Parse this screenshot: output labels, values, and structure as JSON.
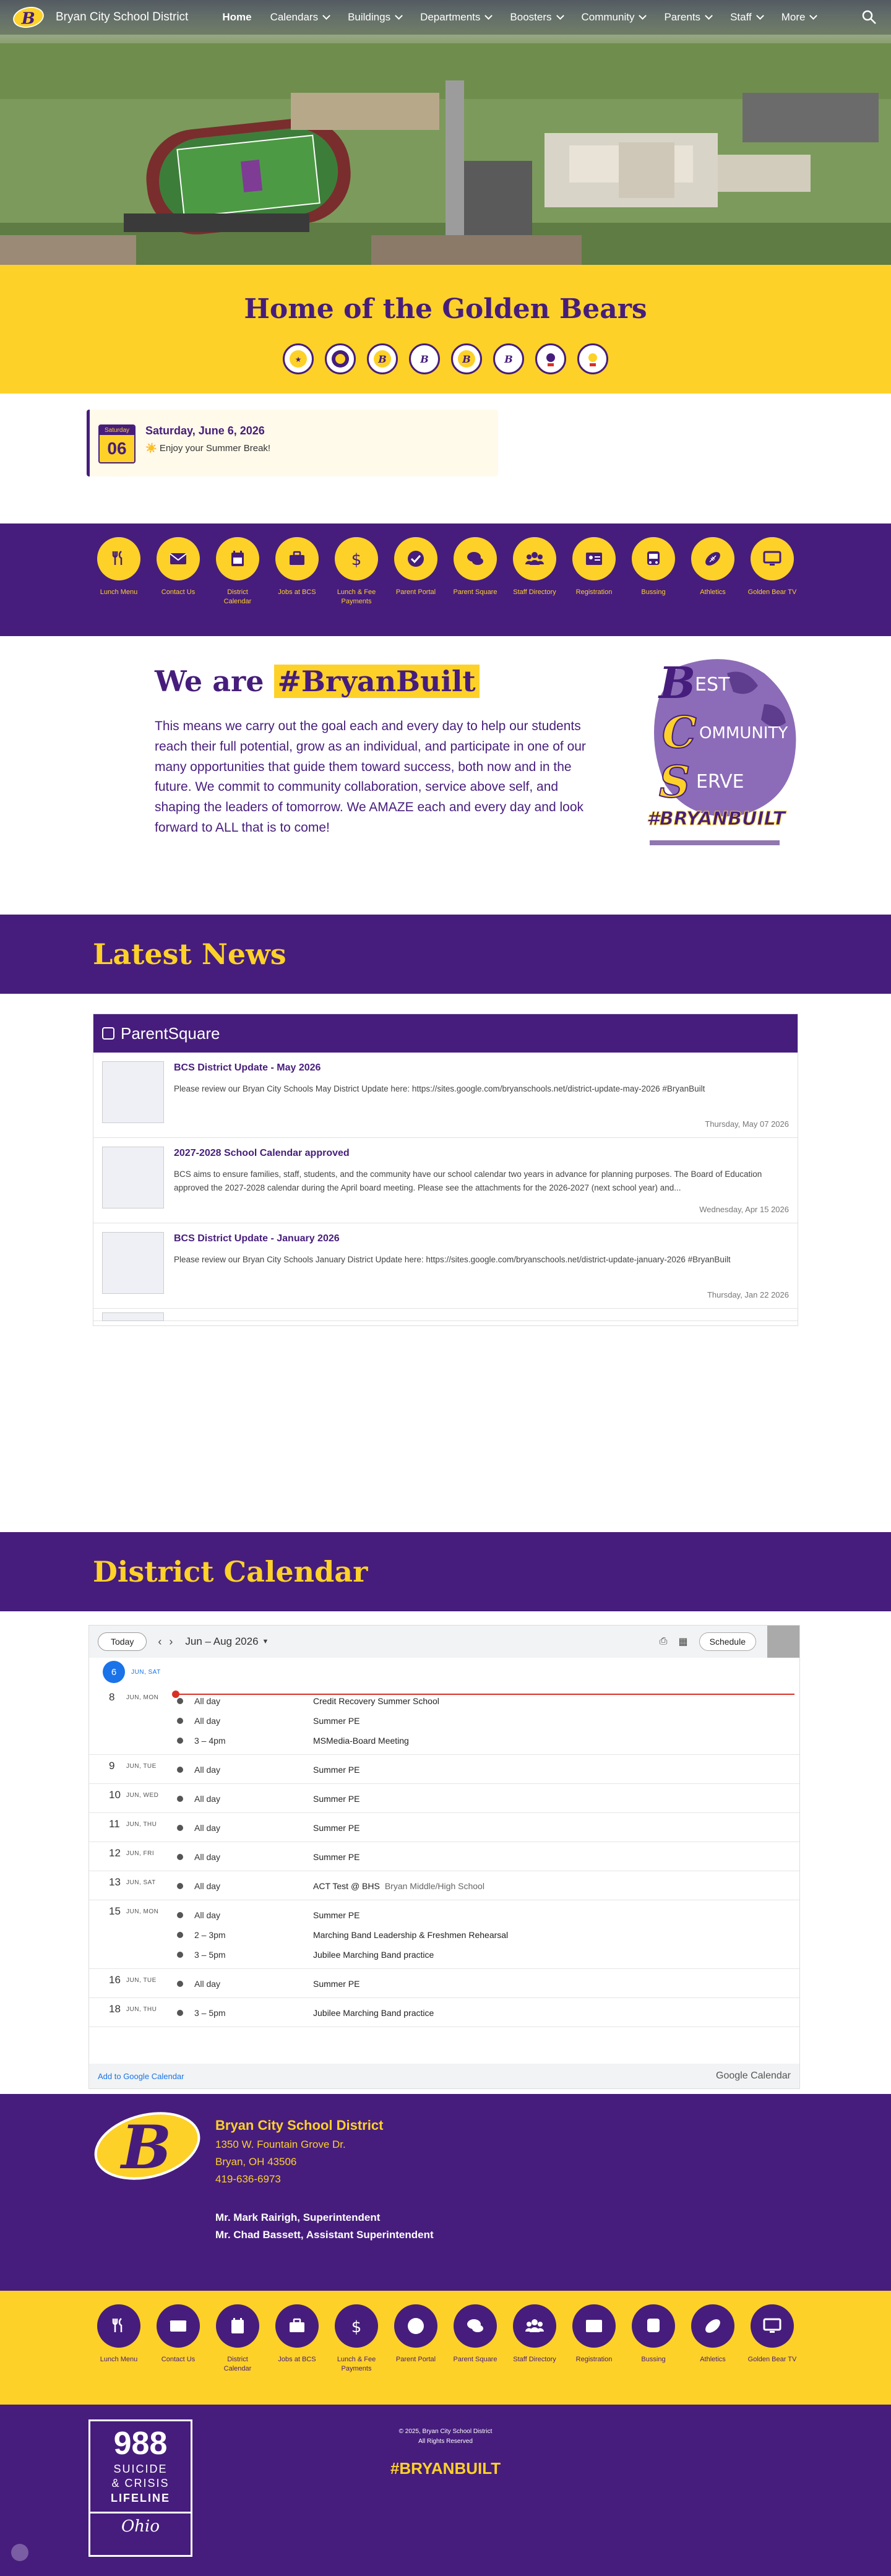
{
  "nav": {
    "site_title": "Bryan City School District",
    "items": [
      {
        "label": "Home",
        "active": true,
        "dropdown": false
      },
      {
        "label": "Calendars",
        "dropdown": true
      },
      {
        "label": "Buildings",
        "dropdown": true
      },
      {
        "label": "Departments",
        "dropdown": true
      },
      {
        "label": "Boosters",
        "dropdown": true
      },
      {
        "label": "Community",
        "dropdown": true
      },
      {
        "label": "Parents",
        "dropdown": true
      },
      {
        "label": "Staff",
        "dropdown": true
      },
      {
        "label": "More",
        "dropdown": true
      }
    ]
  },
  "banner": {
    "title": "Home of the Golden Bears"
  },
  "event": {
    "weekday": "Saturday",
    "day": "06",
    "date": "Saturday, June 6, 2026",
    "text": "☀️ Enjoy your Summer Break!"
  },
  "quick_links": [
    {
      "label": "Lunch Menu",
      "icon": "utensils-icon"
    },
    {
      "label": "Contact Us",
      "icon": "envelope-icon"
    },
    {
      "label": "District Calendar",
      "icon": "calendar-icon"
    },
    {
      "label": "Jobs at BCS",
      "icon": "briefcase-icon"
    },
    {
      "label": "Lunch & Fee Payments",
      "icon": "dollar-icon"
    },
    {
      "label": "Parent Portal",
      "icon": "check-icon"
    },
    {
      "label": "Parent Square",
      "icon": "chat-icon"
    },
    {
      "label": "Staff Directory",
      "icon": "people-icon"
    },
    {
      "label": "Registration",
      "icon": "id-card-icon"
    },
    {
      "label": "Bussing",
      "icon": "bus-icon"
    },
    {
      "label": "Athletics",
      "icon": "football-icon"
    },
    {
      "label": "Golden Bear TV",
      "icon": "monitor-icon"
    }
  ],
  "built": {
    "prefix": "We are",
    "tag": "#BryanBuilt",
    "text": "This means we carry out the goal each and every day to help our students reach their full potential, grow as an individual, and participate in one of our many opportunities that guide them toward success, both now and in the future. We commit to community collaboration, service above self, and shaping the leaders of tomorrow. We AMAZE each and every day and look forward to ALL that is to come!",
    "logo_text": "#BRYANBUILT"
  },
  "news": {
    "heading": "Latest News",
    "brand": "ParentSquare",
    "posts": [
      {
        "title": "BCS District Update - May 2026",
        "text": "Please review our Bryan City Schools May District Update here: https://sites.google.com/bryanschools.net/district-update-may-2026 #BryanBuilt",
        "date": "Thursday, May 07 2026"
      },
      {
        "title": "2027-2028 School Calendar approved",
        "text": "BCS aims to ensure families, staff, students, and the community have our school calendar two years in advance for planning purposes. The Board of Education approved the 2027-2028 calendar during the April board meeting. Please see the attachments for the 2026-2027 (next school year) and...",
        "date": "Wednesday, Apr 15 2026"
      },
      {
        "title": "BCS District Update - January 2026",
        "text": "Please review our Bryan City Schools January District Update here: https://sites.google.com/bryanschools.net/district-update-january-2026 #BryanBuilt",
        "date": "Thursday, Jan 22 2026"
      }
    ]
  },
  "calendar": {
    "heading": "District Calendar",
    "today_label": "Today",
    "range": "Jun – Aug 2026",
    "schedule_label": "Schedule",
    "today": {
      "num": "6",
      "label": "JUN, SAT"
    },
    "days": [
      {
        "num": "8",
        "label": "JUN, MON",
        "events": [
          {
            "time": "All day",
            "name": "Credit Recovery Summer School"
          },
          {
            "time": "All day",
            "name": "Summer PE"
          },
          {
            "time": "3 – 4pm",
            "name": "MSMedia-Board Meeting"
          }
        ]
      },
      {
        "num": "9",
        "label": "JUN, TUE",
        "events": [
          {
            "time": "All day",
            "name": "Summer PE"
          }
        ]
      },
      {
        "num": "10",
        "label": "JUN, WED",
        "events": [
          {
            "time": "All day",
            "name": "Summer PE"
          }
        ]
      },
      {
        "num": "11",
        "label": "JUN, THU",
        "events": [
          {
            "time": "All day",
            "name": "Summer PE"
          }
        ]
      },
      {
        "num": "12",
        "label": "JUN, FRI",
        "events": [
          {
            "time": "All day",
            "name": "Summer PE"
          }
        ]
      },
      {
        "num": "13",
        "label": "JUN, SAT",
        "events": [
          {
            "time": "All day",
            "name": "ACT Test @ BHS",
            "loc": "Bryan Middle/High School"
          }
        ]
      },
      {
        "num": "15",
        "label": "JUN, MON",
        "events": [
          {
            "time": "All day",
            "name": "Summer PE"
          },
          {
            "time": "2 – 3pm",
            "name": "Marching Band Leadership & Freshmen Rehearsal"
          },
          {
            "time": "3 – 5pm",
            "name": "Jubilee Marching Band practice"
          }
        ]
      },
      {
        "num": "16",
        "label": "JUN, TUE",
        "events": [
          {
            "time": "All day",
            "name": "Summer PE"
          }
        ]
      },
      {
        "num": "18",
        "label": "JUN, THU",
        "events": [
          {
            "time": "3 – 5pm",
            "name": "Jubilee Marching Band practice"
          }
        ]
      }
    ],
    "add_link": "Add to Google Calendar",
    "brand": "Google Calendar"
  },
  "footer": {
    "name": "Bryan City School District",
    "address1": "1350 W. Fountain Grove Dr.",
    "address2": "Bryan, OH 43506",
    "phone": "419-636-6973",
    "supt": "Mr. Mark Rairigh, Superintendent",
    "asst": "Mr. Chad Bassett, Assistant Superintendent",
    "copy1": "© 2025, Bryan City School District",
    "copy2": "All Rights Reserved",
    "hashtag": "#BRYANBUILT",
    "lifeline_num": "988",
    "lifeline_l1": "SUICIDE",
    "lifeline_l2": "& CRISIS",
    "lifeline_l3": "LIFELINE",
    "lifeline_state": "Ohio"
  },
  "colors": {
    "purple": "#461d7c",
    "gold": "#fdd128"
  }
}
